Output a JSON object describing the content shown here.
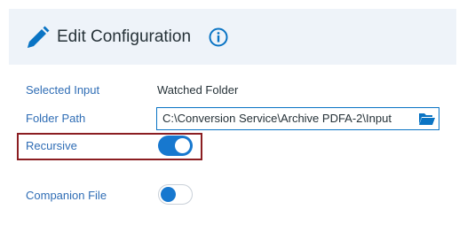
{
  "header": {
    "title": "Edit Configuration"
  },
  "fields": {
    "selected_input": {
      "label": "Selected Input",
      "value": "Watched Folder"
    },
    "folder_path": {
      "label": "Folder Path",
      "value": "C:\\Conversion Service\\Archive PDFA-2\\Input"
    },
    "recursive": {
      "label": "Recursive",
      "state": "on"
    },
    "companion_file": {
      "label": "Companion File",
      "state": "off"
    }
  },
  "colors": {
    "accent": "#1778cf",
    "label": "#2f6db5",
    "highlight": "#8b1e22",
    "header_bg": "#eef3f9"
  }
}
